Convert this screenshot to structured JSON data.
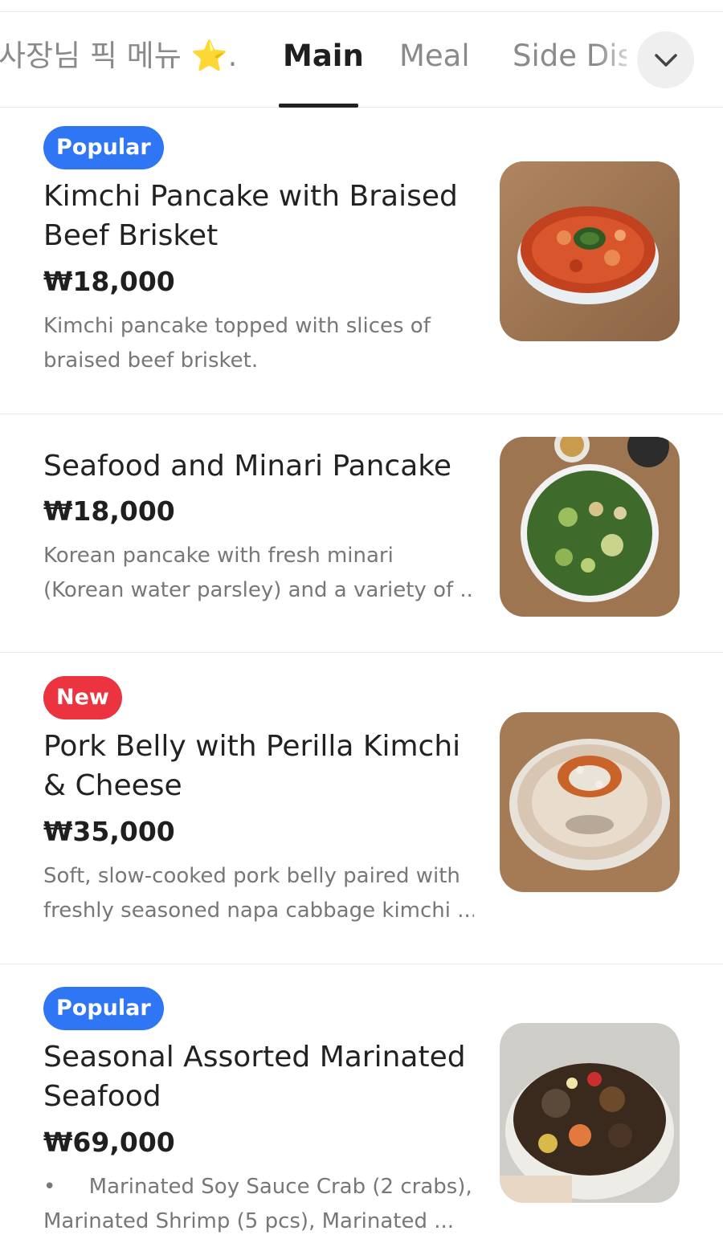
{
  "tabs": [
    {
      "label": "사장님 픽 메뉴 ⭐..."
    },
    {
      "label": "Main"
    },
    {
      "label": "Meal"
    },
    {
      "label": "Side Dis"
    }
  ],
  "items": [
    {
      "badge": "Popular",
      "title_line1": "Kimchi Pancake with Braised",
      "title_line2": "Beef Brisket",
      "price": "₩18,000",
      "desc_line1": "Kimchi pancake topped with slices of",
      "desc_line2": "braised beef brisket."
    },
    {
      "title_line1": "Seafood and Minari Pancake",
      "price": "₩18,000",
      "desc_line1": "Korean pancake with fresh minari",
      "desc_line2": "(Korean water parsley) and a variety of ..."
    },
    {
      "badge": "New",
      "title_line1": "Pork Belly with Perilla Kimchi",
      "title_line2": "& Cheese",
      "price": "₩35,000",
      "desc_line1": "Soft, slow-cooked pork belly paired with",
      "desc_line2": "freshly seasoned napa cabbage kimchi ..."
    },
    {
      "badge": "Popular",
      "title_line1": "Seasonal Assorted Marinated",
      "title_line2": "Seafood",
      "price": "₩69,000",
      "desc_line1": "•     Marinated Soy Sauce Crab (2 crabs),",
      "desc_line2": "Marinated Shrimp (5 pcs), Marinated ..."
    }
  ],
  "colors": {
    "popular_badge": "#2f76f5",
    "new_badge": "#ec3340"
  }
}
